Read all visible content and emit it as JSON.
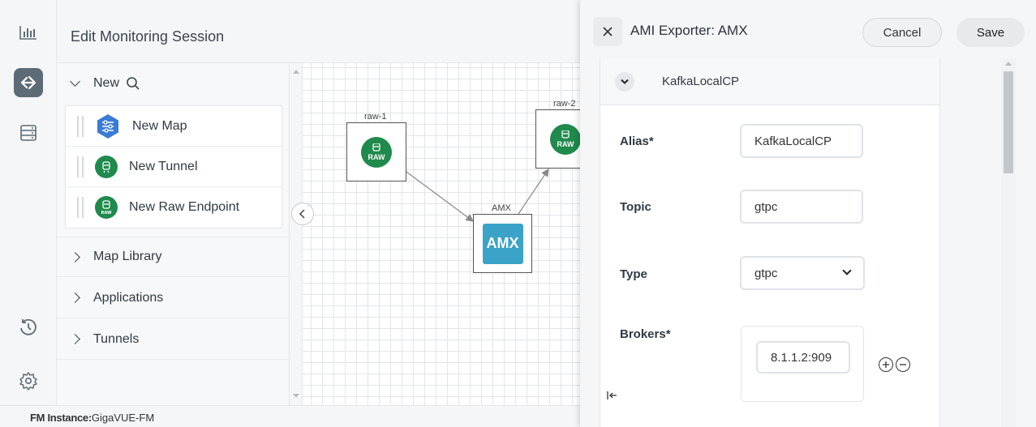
{
  "header": {
    "title": "Edit Monitoring Session"
  },
  "tree": {
    "new_label": "New",
    "new_items": [
      {
        "label": "New Map",
        "icon": "map-settings-icon"
      },
      {
        "label": "New Tunnel",
        "icon": "tunnel-icon"
      },
      {
        "label": "New Raw Endpoint",
        "icon": "raw-endpoint-icon"
      }
    ],
    "sections": [
      "Map Library",
      "Applications",
      "Tunnels"
    ]
  },
  "canvas": {
    "nodes": [
      {
        "label": "raw-1",
        "badge": "RAW"
      },
      {
        "label": "raw-2",
        "badge": "RAW"
      },
      {
        "label": "AMX",
        "badge": "AMX"
      }
    ]
  },
  "footer": {
    "label": "FM Instance:",
    "value": "GigaVUE-FM"
  },
  "drawer": {
    "title": "AMI Exporter: AMX",
    "cancel_label": "Cancel",
    "save_label": "Save",
    "section_label": "KafkaLocalCP",
    "fields": {
      "alias_label": "Alias*",
      "alias_value": "KafkaLocalCP",
      "topic_label": "Topic",
      "topic_value": "gtpc",
      "type_label": "Type",
      "type_value": "gtpc",
      "brokers_label": "Brokers*",
      "brokers_value": "8.1.1.2:909"
    }
  },
  "colors": {
    "accent_green": "#1f8a4c",
    "amx_blue": "#3ba3c7",
    "rail_active": "#5d6b77",
    "map_blue": "#3a7bd5"
  }
}
